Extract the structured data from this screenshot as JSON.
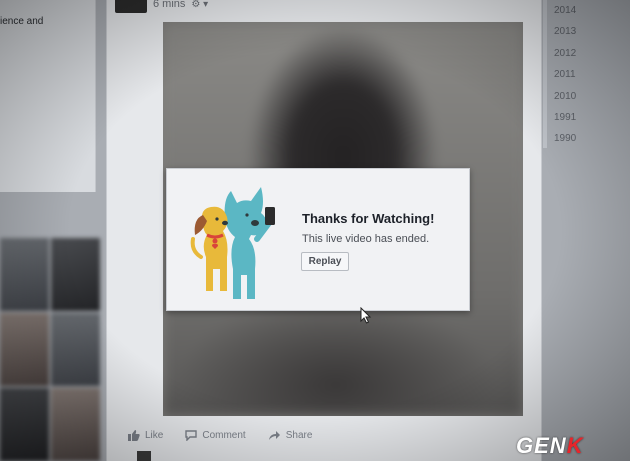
{
  "left_column": {
    "card_text": "ience and"
  },
  "post": {
    "timestamp": "6 mins",
    "privacy_icon": "gear-icon",
    "dialog": {
      "title": "Thanks for Watching!",
      "message": "This live video has ended.",
      "replay_label": "Replay",
      "illustration": "dogs-selfie-illustration"
    },
    "actions": {
      "like_label": "Like",
      "comment_label": "Comment",
      "share_label": "Share"
    }
  },
  "timeline": {
    "years": [
      "2014",
      "2013",
      "2012",
      "2011",
      "2010",
      "1991",
      "1990"
    ]
  },
  "watermark": {
    "text_main": "GEN",
    "text_accent": "K"
  },
  "colors": {
    "page_bg": "#a9adb3",
    "card_bg": "#e6e8eb",
    "dialog_bg": "#f1f2f4",
    "dog_blue": "#5bb7c4",
    "dog_yellow": "#e8b93a",
    "collar_red": "#d9453a",
    "watermark_accent": "#e8252b"
  }
}
